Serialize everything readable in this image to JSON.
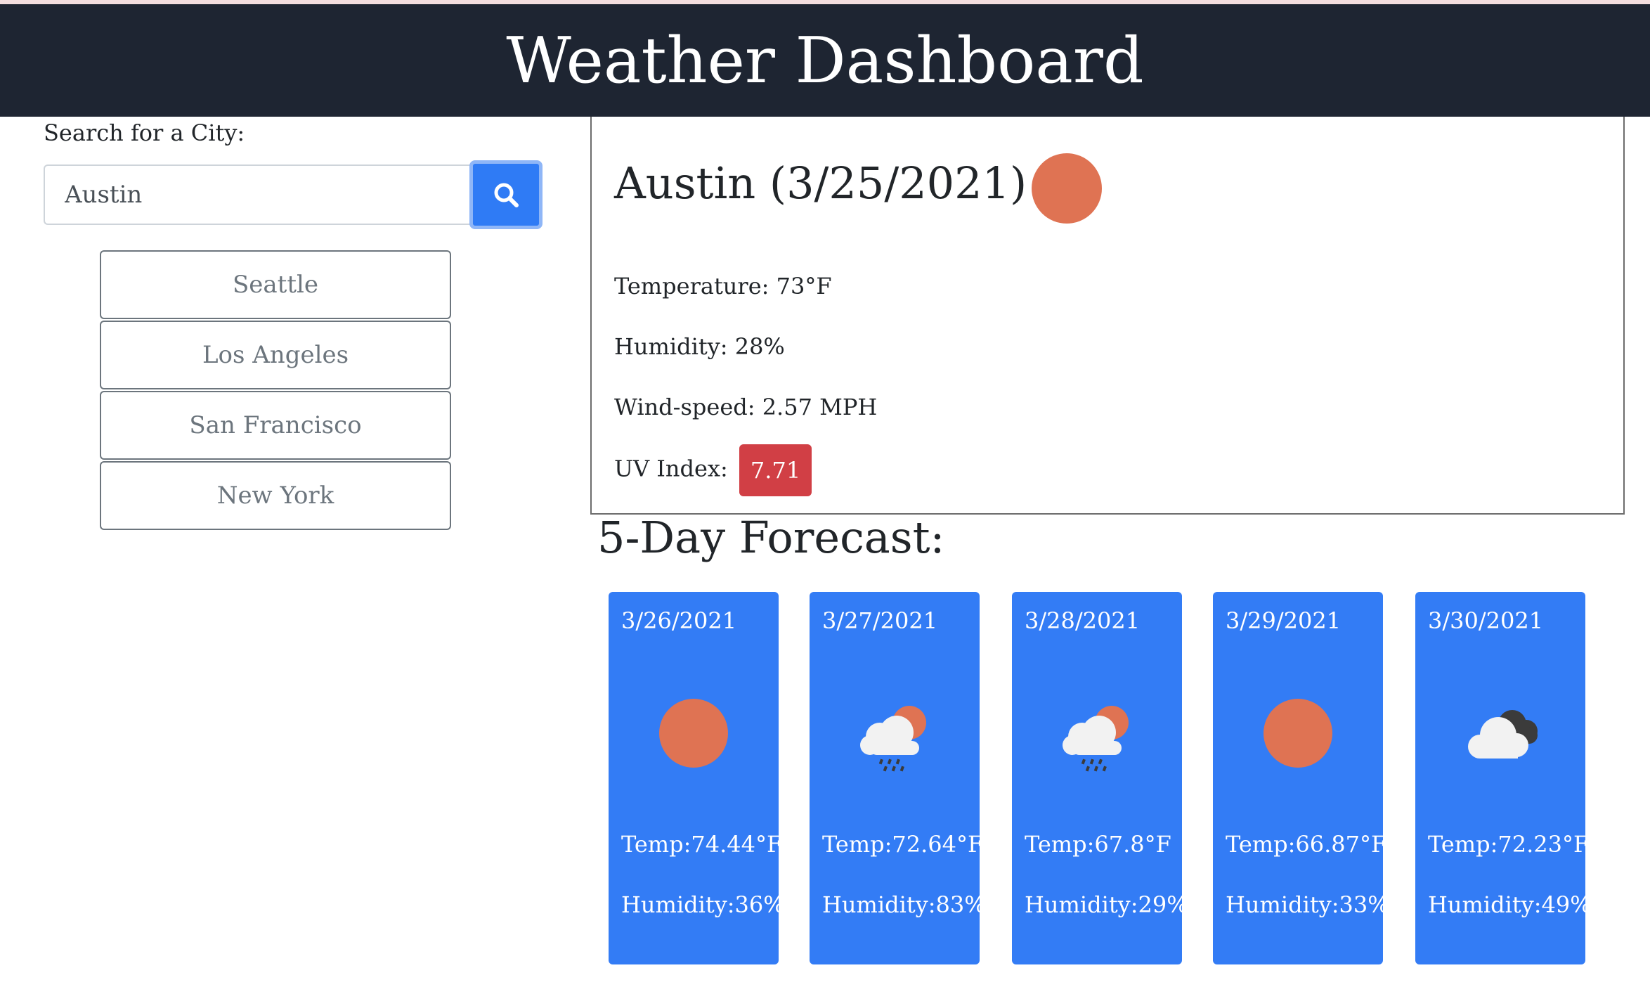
{
  "header": {
    "title": "Weather Dashboard"
  },
  "search": {
    "label": "Search for a City:",
    "value": "Austin",
    "placeholder": "",
    "button_icon": "search-icon"
  },
  "history": [
    "Seattle",
    "Los Angeles",
    "San Francisco",
    "New York"
  ],
  "current": {
    "title": "Austin (3/25/2021)",
    "icon": "sun-icon",
    "temperature": "Temperature: 73°F",
    "humidity": "Humidity: 28%",
    "wind": "Wind-speed: 2.57 MPH",
    "uv_label": "UV Index:",
    "uv_value": "7.71"
  },
  "forecast": {
    "title": "5-Day Forecast:",
    "days": [
      {
        "date": "3/26/2021",
        "icon": "sun-icon",
        "temp": "Temp:74.44°F",
        "humidity": "Humidity:36%"
      },
      {
        "date": "3/27/2021",
        "icon": "rain-cloud-sun-icon",
        "temp": "Temp:72.64°F",
        "humidity": "Humidity:83%"
      },
      {
        "date": "3/28/2021",
        "icon": "rain-cloud-sun-icon",
        "temp": "Temp:67.8°F",
        "humidity": "Humidity:29%"
      },
      {
        "date": "3/29/2021",
        "icon": "sun-icon",
        "temp": "Temp:66.87°F",
        "humidity": "Humidity:33%"
      },
      {
        "date": "3/30/2021",
        "icon": "broken-clouds-icon",
        "temp": "Temp:72.23°F",
        "humidity": "Humidity:49%"
      }
    ]
  },
  "colors": {
    "header_bg": "#1e2532",
    "accent_blue": "#337cf5",
    "uv_high": "#d13f45",
    "sun": "#df7353"
  }
}
